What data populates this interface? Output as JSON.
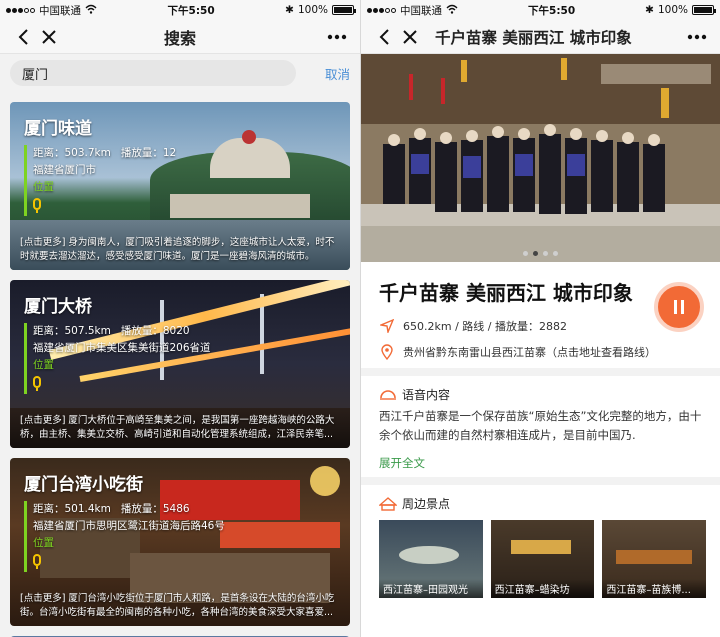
{
  "left": {
    "status": {
      "carrier": "中国联通",
      "time": "下午5:50",
      "battery": "100%",
      "battery_level": 1.0
    },
    "nav": {
      "title": "搜索"
    },
    "search": {
      "value": "厦门",
      "cancel": "取消"
    },
    "results": [
      {
        "title": "厦门味道",
        "distance": "距离：503.7km",
        "plays": "播放量：12",
        "address": "福建省厦门市",
        "location_link": "位置",
        "desc": "[点击更多] 身为闽南人，厦门吸引着追逐的脚步，这座城市让人太爱，时不时就要去溜达溜达，感受感受厦门味道。厦门是一座碧海风清的城市。"
      },
      {
        "title": "厦门大桥",
        "distance": "距离：507.5km",
        "plays": "播放量：8020",
        "address": "福建省厦门市集美区集美街道206省道",
        "location_link": "位置",
        "desc": "[点击更多] 厦门大桥位于高崎至集美之间，是我国第一座跨越海峡的公路大桥，由主桥、集美立交桥、高崎引道和自动化管理系统组成，江泽民亲笔..."
      },
      {
        "title": "厦门台湾小吃街",
        "distance": "距离：501.4km",
        "plays": "播放量：5486",
        "address": "福建省厦门市思明区鹭江街道海后路46号",
        "location_link": "位置",
        "desc": "[点击更多] 厦门台湾小吃街位于厦门市人和路，是首条设在大陆的台湾小吃街。台湾小吃街有最全的闽南的各种小吃，各种台湾的美食深受大家喜爱..."
      }
    ]
  },
  "right": {
    "status": {
      "carrier": "中国联通",
      "time": "下午5:50",
      "battery": "100%",
      "battery_level": 1.0
    },
    "nav": {
      "title": "千户苗寨 美丽西江 城市印象"
    },
    "carousel": {
      "count": 4,
      "active": 1
    },
    "detail": {
      "title": "千户苗寨 美丽西江 城市印象",
      "stats": "650.2km / 路线 / 播放量：2882",
      "address": "贵州省黔东南雷山县西江苗寨",
      "route_link": "（点击地址查看路线）"
    },
    "audio": {
      "heading": "语音内容",
      "text": "西江千户苗寨是一个保存苗族“原始生态”文化完整的地方，由十余个依山而建的自然村寨相连成片，是目前中国乃.",
      "expand": "展开全文"
    },
    "nearby": {
      "heading": "周边景点",
      "items": [
        {
          "label": "西江苗寨–田园观光"
        },
        {
          "label": "西江苗寨–蜡染坊"
        },
        {
          "label": "西江苗寨–苗族博..."
        }
      ]
    }
  },
  "colors": {
    "accent": "#f26a36",
    "green": "#7ed321",
    "link_blue": "#4a8fd6"
  }
}
